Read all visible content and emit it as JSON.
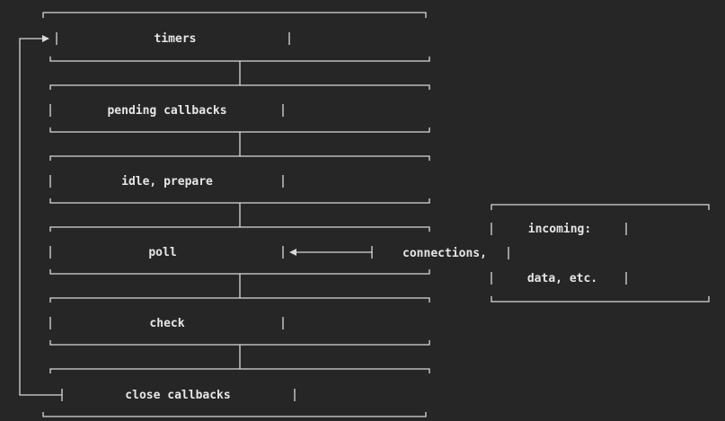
{
  "diagram": {
    "phases": [
      {
        "label": "timers"
      },
      {
        "label": "pending callbacks"
      },
      {
        "label": "idle, prepare"
      },
      {
        "label": "poll"
      },
      {
        "label": "check"
      },
      {
        "label": "close callbacks"
      }
    ],
    "incoming": {
      "lines": [
        "incoming:",
        "connections,",
        "data, etc."
      ]
    }
  }
}
